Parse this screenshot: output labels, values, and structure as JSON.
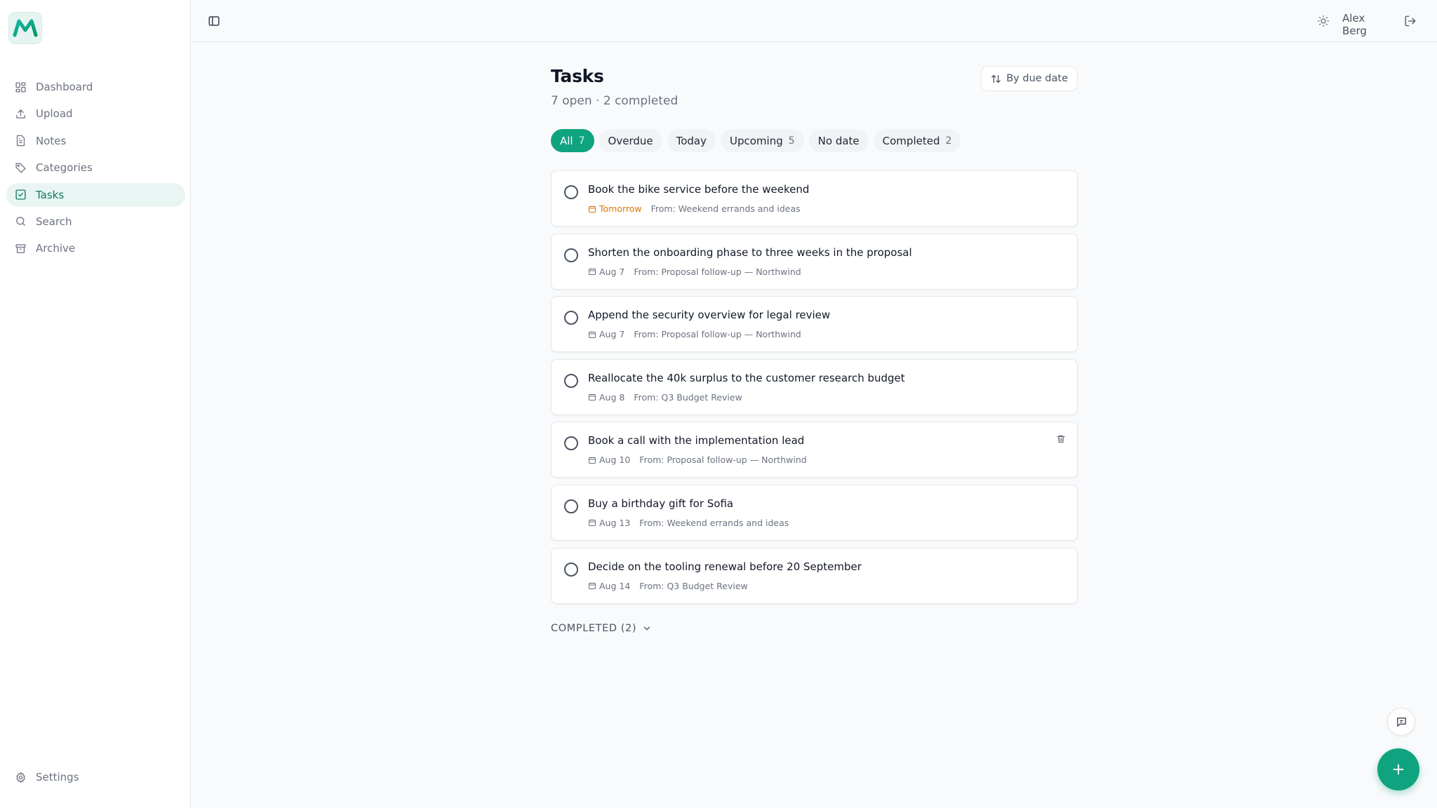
{
  "app": {
    "logo_letter": "M",
    "accent": "#10a37f"
  },
  "sidebar": {
    "items": [
      {
        "label": "Dashboard",
        "icon": "dashboard-icon"
      },
      {
        "label": "Upload",
        "icon": "upload-icon"
      },
      {
        "label": "Notes",
        "icon": "notes-icon"
      },
      {
        "label": "Categories",
        "icon": "tag-icon"
      },
      {
        "label": "Tasks",
        "icon": "checkbox-icon",
        "active": true
      },
      {
        "label": "Search",
        "icon": "search-icon"
      },
      {
        "label": "Archive",
        "icon": "archive-icon"
      }
    ],
    "settings_label": "Settings"
  },
  "topbar": {
    "user_name": "Alex Berg"
  },
  "page": {
    "title": "Tasks",
    "summary": "7 open · 2 completed",
    "sort_label": "By due date"
  },
  "filters": [
    {
      "label": "All",
      "count": "7",
      "active": true
    },
    {
      "label": "Overdue",
      "count": ""
    },
    {
      "label": "Today",
      "count": ""
    },
    {
      "label": "Upcoming",
      "count": "5"
    },
    {
      "label": "No date",
      "count": ""
    },
    {
      "label": "Completed",
      "count": "2"
    }
  ],
  "tasks": [
    {
      "title": "Book the bike service before the weekend",
      "due": "Tomorrow",
      "source": "From: Weekend errands and ideas",
      "due_color": "#d97706"
    },
    {
      "title": "Shorten the onboarding phase to three weeks in the proposal",
      "due": "Aug 7",
      "source": "From: Proposal follow-up — Northwind"
    },
    {
      "title": "Append the security overview for legal review",
      "due": "Aug 7",
      "source": "From: Proposal follow-up — Northwind"
    },
    {
      "title": "Reallocate the 40k surplus to the customer research budget",
      "due": "Aug 8",
      "source": "From: Q3 Budget Review"
    },
    {
      "title": "Book a call with the implementation lead",
      "due": "Aug 10",
      "source": "From: Proposal follow-up — Northwind",
      "hovered": true
    },
    {
      "title": "Buy a birthday gift for Sofia",
      "due": "Aug 13",
      "source": "From: Weekend errands and ideas"
    },
    {
      "title": "Decide on the tooling renewal before 20 September",
      "due": "Aug 14",
      "source": "From: Q3 Budget Review"
    }
  ],
  "completed_section": {
    "label": "COMPLETED (2)"
  }
}
